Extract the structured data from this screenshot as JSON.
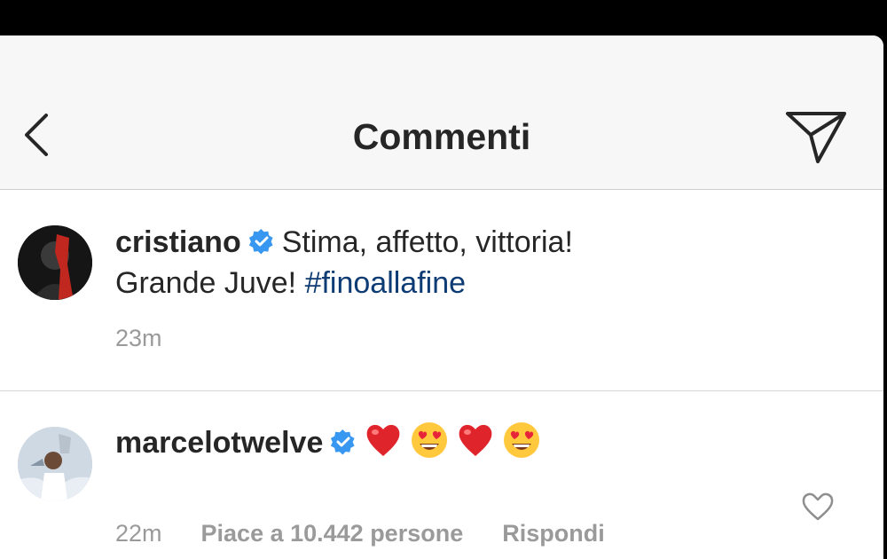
{
  "header": {
    "title": "Commenti"
  },
  "comments": [
    {
      "username": "cristiano",
      "text_line1": "Stima, affetto, vittoria!",
      "text_line2": "Grande Juve! ",
      "hashtag": "#finoallafine",
      "time": "23m"
    },
    {
      "username": "marcelotwelve",
      "emojis": [
        "red-heart",
        "heart-eyes",
        "red-heart",
        "heart-eyes"
      ],
      "time": "22m",
      "likes": "Piace a 10.442 persone",
      "reply": "Rispondi"
    }
  ],
  "colors": {
    "verified": "#3897f0",
    "hashtag": "#0d3b73",
    "meta": "#9a9a9a"
  }
}
